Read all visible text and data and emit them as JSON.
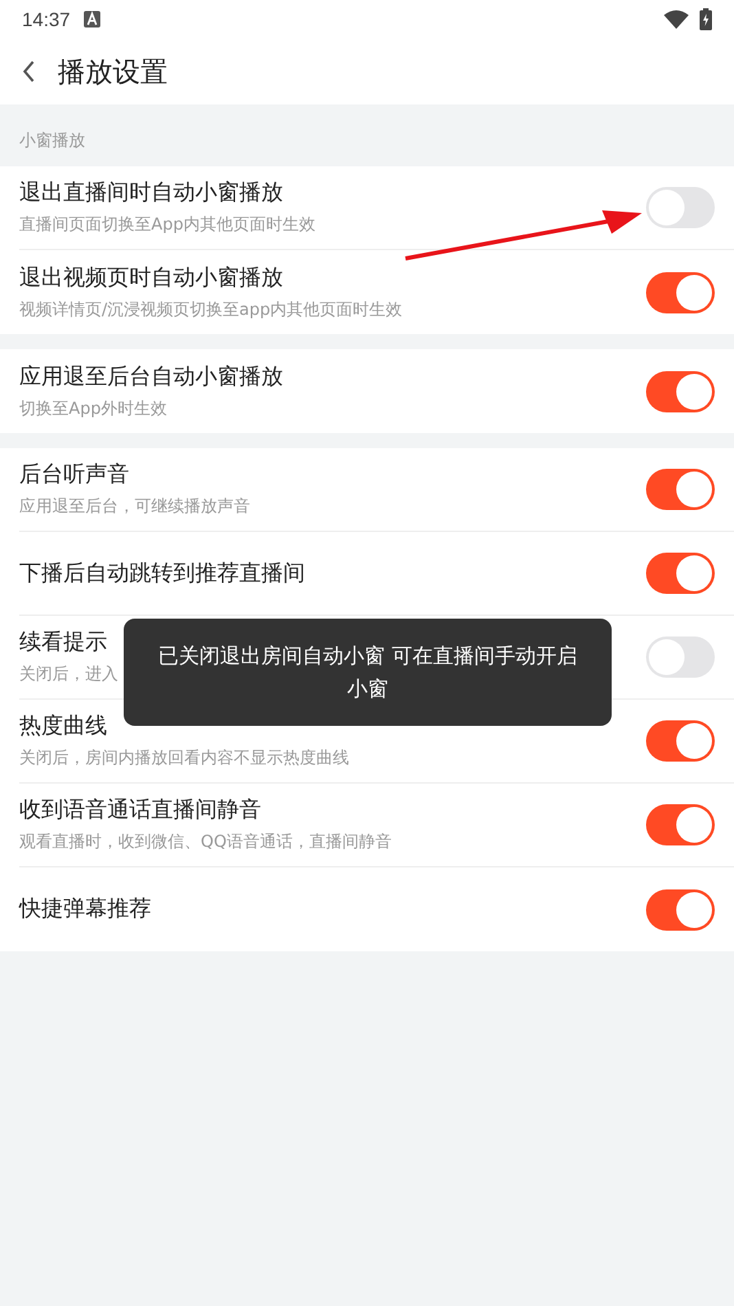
{
  "status_bar": {
    "time": "14:37"
  },
  "header": {
    "title": "播放设置"
  },
  "groups": [
    {
      "label": "小窗播放",
      "items": [
        {
          "title": "退出直播间时自动小窗播放",
          "subtitle": "直播间页面切换至App内其他页面时生效",
          "on": false
        },
        {
          "title": "退出视频页时自动小窗播放",
          "subtitle": "视频详情页/沉浸视频页切换至app内其他页面时生效",
          "on": true
        }
      ]
    },
    {
      "items": [
        {
          "title": "应用退至后台自动小窗播放",
          "subtitle": "切换至App外时生效",
          "on": true
        }
      ]
    },
    {
      "items": [
        {
          "title": "后台听声音",
          "subtitle": "应用退至后台，可继续播放声音",
          "on": true
        },
        {
          "title": "下播后自动跳转到推荐直播间",
          "on": true
        },
        {
          "title": "续看提示",
          "subtitle": "关闭后，进入",
          "on": false
        },
        {
          "title": "热度曲线",
          "subtitle": "关闭后，房间内播放回看内容不显示热度曲线",
          "on": true
        },
        {
          "title": "收到语音通话直播间静音",
          "subtitle": "观看直播时，收到微信、QQ语音通话，直播间静音",
          "on": true
        },
        {
          "title": "快捷弹幕推荐",
          "on": true
        }
      ]
    }
  ],
  "toast": {
    "text": "已关闭退出房间自动小窗 可在直播间手动开启小窗"
  }
}
